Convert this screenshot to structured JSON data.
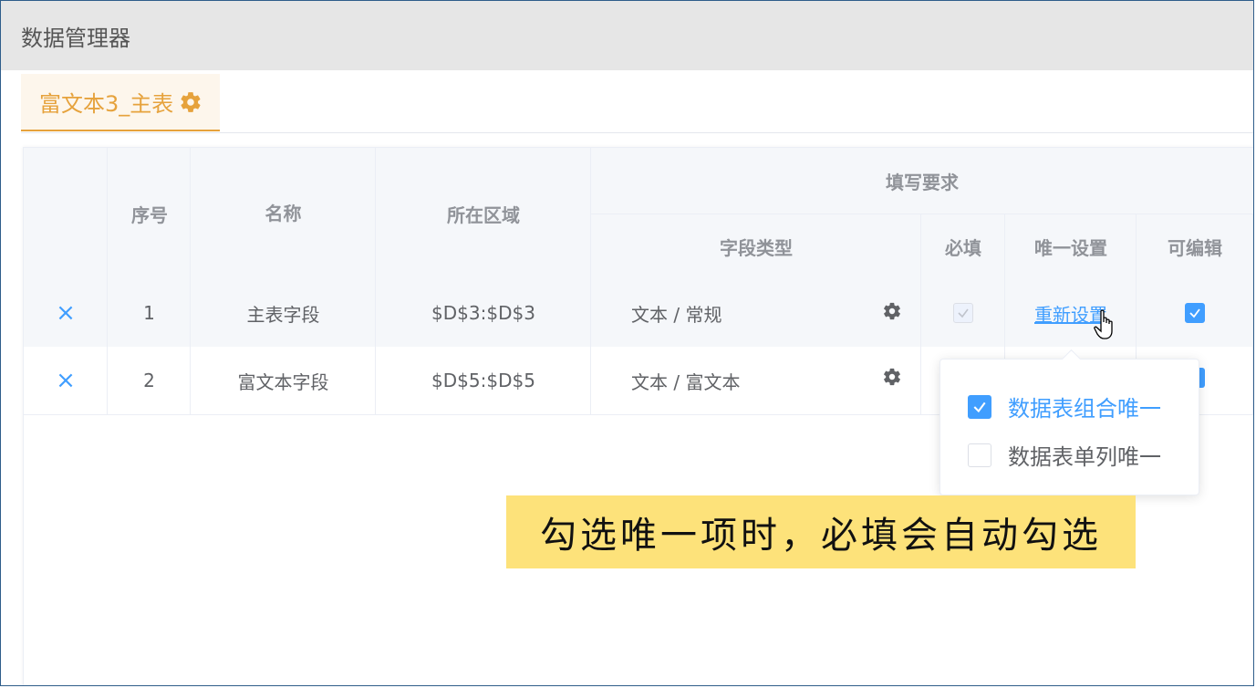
{
  "window": {
    "title": "数据管理器"
  },
  "tab": {
    "label": "富文本3_主表",
    "icon": "gear-icon",
    "color": "#e6a23c"
  },
  "table": {
    "headers": {
      "index": "序号",
      "name": "名称",
      "region": "所在区域",
      "group": "填写要求",
      "field_type": "字段类型",
      "required": "必填",
      "unique": "唯一设置",
      "editable": "可编辑"
    },
    "rows": [
      {
        "delete": "×",
        "index": "1",
        "name": "主表字段",
        "region": "$D$3:$D$3",
        "field_type": "文本 / 常规",
        "required": true,
        "required_disabled": true,
        "unique_link": "重新设置",
        "editable": true
      },
      {
        "delete": "×",
        "index": "2",
        "name": "富文本字段",
        "region": "$D$5:$D$5",
        "field_type": "文本 / 富文本",
        "editable": true
      }
    ]
  },
  "popover": {
    "options": [
      {
        "label": "数据表组合唯一",
        "checked": true
      },
      {
        "label": "数据表单列唯一",
        "checked": false
      }
    ]
  },
  "caption": "勾选唯一项时，必填会自动勾选",
  "colors": {
    "accent": "#409eff",
    "caption_bg": "#fde27a",
    "header_bg": "#f5f7fa"
  }
}
